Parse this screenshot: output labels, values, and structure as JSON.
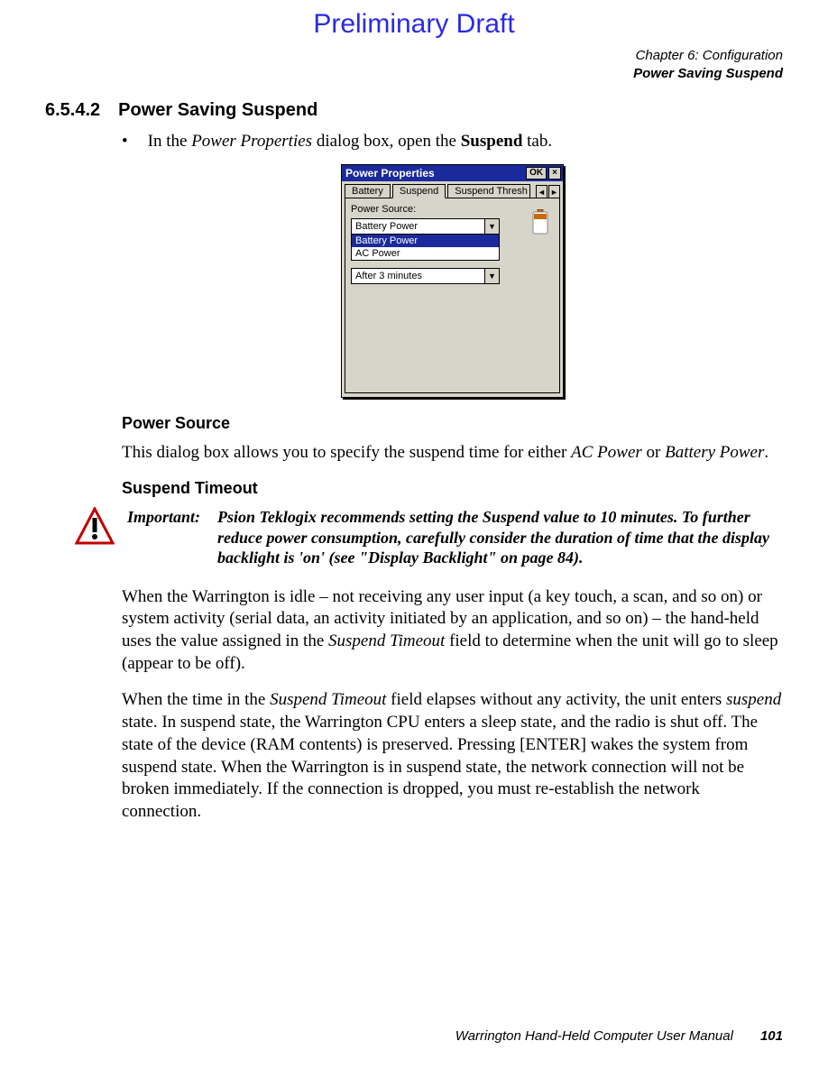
{
  "draft": "Preliminary Draft",
  "chapter": {
    "line1": "Chapter 6: Configuration",
    "line2": "Power Saving Suspend"
  },
  "section": {
    "number": "6.5.4.2",
    "title": "Power Saving Suspend"
  },
  "bullet": {
    "pre": "In the ",
    "italic": "Power Properties",
    "mid": " dialog box, open the ",
    "bold": "Suspend",
    "post": " tab."
  },
  "dialog": {
    "title": "Power Properties",
    "ok": "OK",
    "close": "×",
    "tabs": {
      "battery": "Battery",
      "suspend": "Suspend",
      "thresh": "Suspend Thresh"
    },
    "scroll_left": "◄",
    "scroll_right": "►",
    "group_label": "Power Source:",
    "combo1_value": "Battery Power",
    "combo1_arrow": "▼",
    "list_item1": "Battery Power",
    "list_item2": "AC Power",
    "combo2_value": "After 3 minutes",
    "combo2_arrow": "▼"
  },
  "power_source": {
    "heading": "Power Source",
    "p_pre": "This dialog box allows you to specify the suspend time for either ",
    "p_i1": "AC Power",
    "p_mid": " or ",
    "p_i2": "Battery Power",
    "p_post": "."
  },
  "suspend_timeout": {
    "heading": "Suspend Timeout"
  },
  "important": {
    "label": "Important:",
    "text": "Psion Teklogix recommends setting the Suspend value to 10 minutes. To further reduce power consumption, carefully consider the duration of time that the display backlight is 'on' (see \"Display Backlight\" on page 84)."
  },
  "para1": {
    "pre": "When the Warrington is idle – not receiving any user input (a key touch, a scan, and so on) or system activity (serial data, an activity initiated by an application, and so on) – the hand-held uses the value assigned in the ",
    "i1": "Suspend Timeout",
    "post": " field to determine when the unit will go to sleep (appear to be off)."
  },
  "para2": {
    "pre": "When the time in the ",
    "i1": "Suspend Timeout",
    "mid1": " field elapses without any activity, the unit enters ",
    "i2": "suspend",
    "post": " state. In suspend state, the Warrington CPU enters a sleep state, and the radio is shut off. The state of the device (RAM contents) is preserved. Pressing [ENTER] wakes the system from suspend state. When the Warrington is in suspend state, the network connection will not be broken immediately. If the connection is dropped, you must re-establish the network connection."
  },
  "footer": {
    "text": "Warrington Hand-Held Computer User Manual",
    "page": "101"
  }
}
